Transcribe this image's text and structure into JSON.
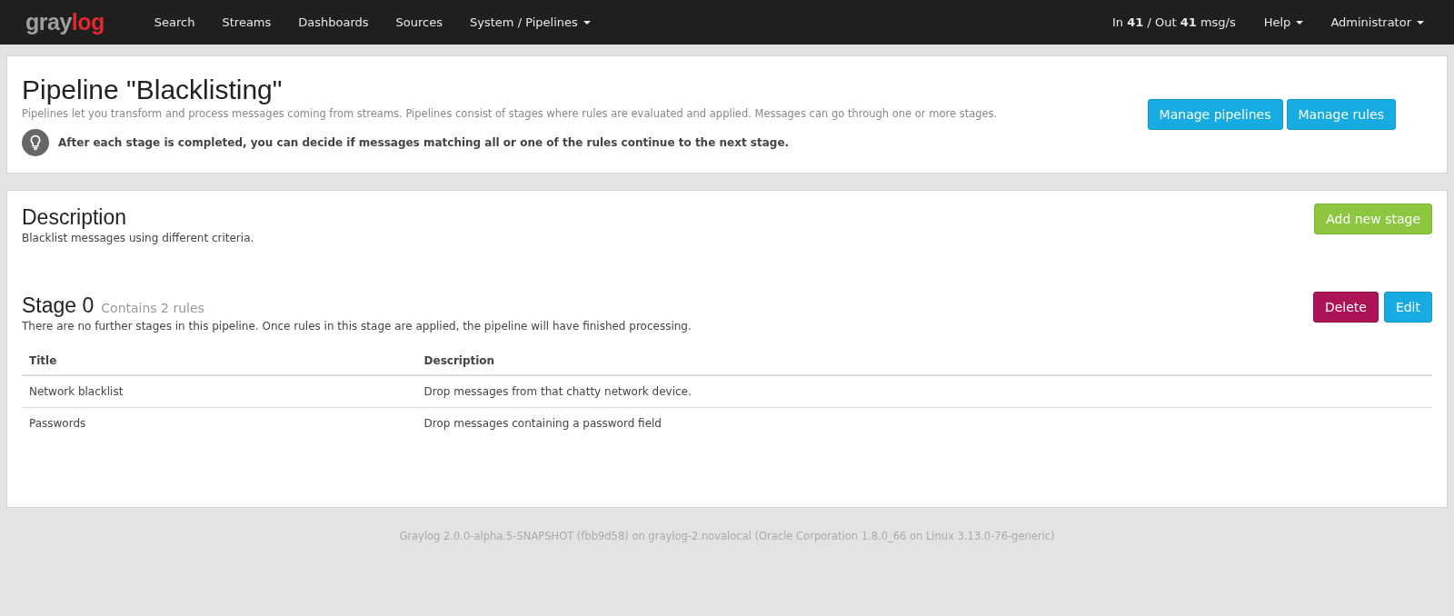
{
  "navbar": {
    "logo": [
      "gray",
      "log"
    ],
    "items": [
      {
        "label": "Search",
        "dropdown": false
      },
      {
        "label": "Streams",
        "dropdown": false
      },
      {
        "label": "Dashboards",
        "dropdown": false
      },
      {
        "label": "Sources",
        "dropdown": false
      },
      {
        "label": "System / Pipelines",
        "dropdown": true
      }
    ],
    "throughput": "In **41** / Out **41** msg/s",
    "right_items": [
      {
        "label": "Help",
        "dropdown": true
      },
      {
        "label": "Administrator",
        "dropdown": true
      }
    ]
  },
  "header": {
    "title": "Pipeline \"Blacklisting\"",
    "subtitle": "Pipelines let you transform and process messages coming from streams. Pipelines consist of stages where rules are evaluated and applied. Messages can go through one or more stages.",
    "tip": "After each stage is completed, you can decide if messages matching all or one of the rules continue to the next stage.",
    "buttons": [
      {
        "label": "Manage pipelines",
        "kind": "info"
      },
      {
        "label": "Manage rules",
        "kind": "info"
      }
    ]
  },
  "description": {
    "title": "Description",
    "text": "Blacklist messages using different criteria.",
    "button": {
      "label": "Add new stage",
      "kind": "success"
    }
  },
  "stages": [
    {
      "title": "Stage 0",
      "count": "Contains 2 rules",
      "text": "There are no further stages in this pipeline. Once rules in this stage are applied, the pipeline will have finished processing.",
      "buttons": [
        {
          "label": "Delete",
          "kind": "danger"
        },
        {
          "label": "Edit",
          "kind": "info"
        }
      ],
      "columns": [
        "Title",
        "Description"
      ],
      "rows": [
        [
          "Network blacklist",
          "Drop messages from that chatty network device."
        ],
        [
          "Passwords",
          "Drop messages containing a password field"
        ]
      ]
    }
  ],
  "footer": "Graylog 2.0.0-alpha.5-SNAPSHOT (fbb9d58) on graylog-2.novalocal (Oracle Corporation 1.8.0_66 on Linux 3.13.0-76-generic)"
}
